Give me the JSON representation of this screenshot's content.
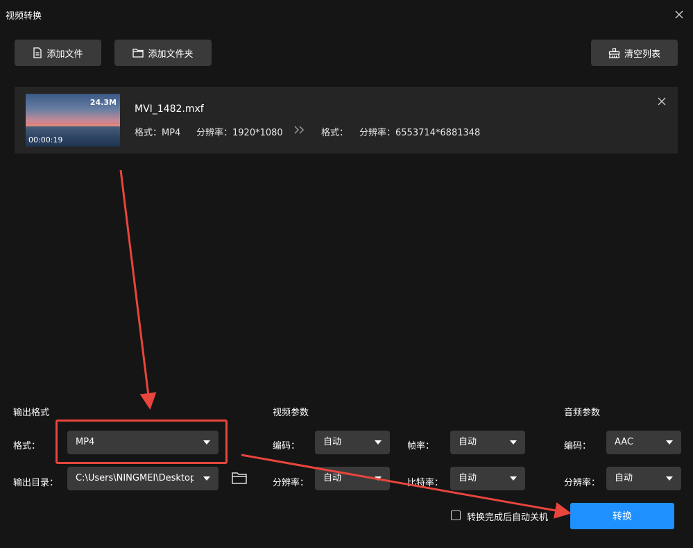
{
  "window": {
    "title": "视频转换"
  },
  "toolbar": {
    "add_file_label": "添加文件",
    "add_folder_label": "添加文件夹",
    "clear_list_label": "清空列表"
  },
  "file": {
    "name": "MVI_1482.mxf",
    "size": "24.3M",
    "duration": "00:00:19",
    "source": {
      "format": "格式：MP4",
      "resolution": "分辨率：1920*1080"
    },
    "target": {
      "format": "格式：",
      "resolution": "分辨率：6553714*6881348"
    }
  },
  "output": {
    "section_title": "输出格式",
    "format_label": "格式：",
    "format_value": "MP4",
    "dir_label": "输出目录：",
    "dir_value": "C:\\Users\\NINGMEI\\Desktop"
  },
  "video_params": {
    "section_title": "视频参数",
    "codec_label": "编码：",
    "codec_value": "自动",
    "framerate_label": "帧率：",
    "framerate_value": "自动",
    "resolution_label": "分辨率：",
    "resolution_value": "自动",
    "bitrate_label": "比特率：",
    "bitrate_value": "自动"
  },
  "audio_params": {
    "section_title": "音频参数",
    "codec_label": "编码：",
    "codec_value": "AAC",
    "resolution_label": "分辨率：",
    "resolution_value": "自动"
  },
  "footer": {
    "shutdown_label": "转换完成后自动关机",
    "convert_label": "转换"
  },
  "colors": {
    "background": "#151515",
    "button_bg": "#3a3a3a",
    "accent": "#1e90ff",
    "annotation": "#e8453c"
  }
}
